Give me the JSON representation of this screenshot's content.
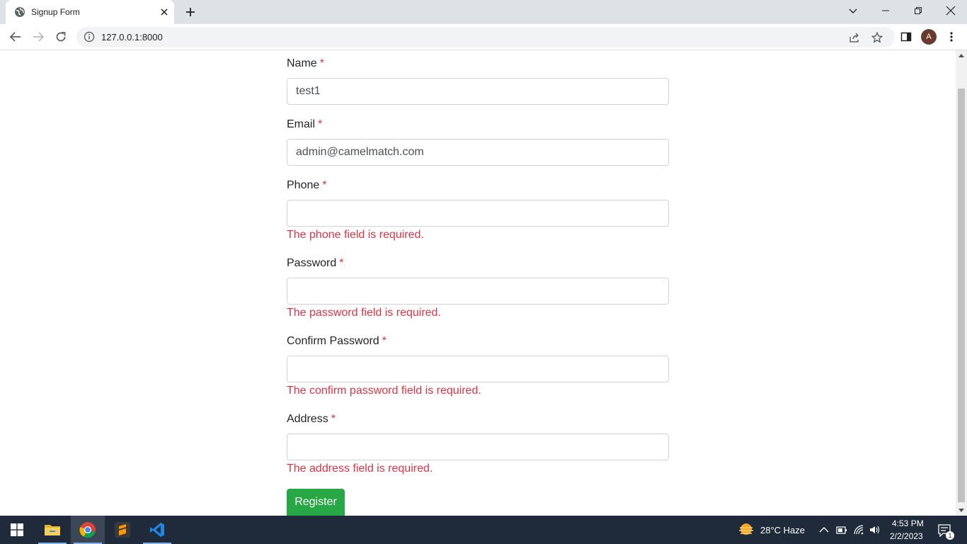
{
  "browser": {
    "tab_title": "Signup Form",
    "url": "127.0.0.1:8000",
    "profile_initial": "A"
  },
  "form": {
    "fields": [
      {
        "label": "Name",
        "required": "*",
        "value": "test1",
        "error": ""
      },
      {
        "label": "Email",
        "required": "*",
        "value": "admin@camelmatch.com",
        "error": ""
      },
      {
        "label": "Phone",
        "required": "*",
        "value": "",
        "error": "The phone field is required."
      },
      {
        "label": "Password",
        "required": "*",
        "value": "",
        "error": "The password field is required."
      },
      {
        "label": "Confirm Password",
        "required": "*",
        "value": "",
        "error": "The confirm password field is required."
      },
      {
        "label": "Address",
        "required": "*",
        "value": "",
        "error": "The address field is required."
      }
    ],
    "submit_label": "Register"
  },
  "taskbar": {
    "weather": "28°C  Haze",
    "time": "4:53 PM",
    "date": "2/2/2023",
    "notification_count": "1",
    "apps": [
      "start-icon",
      "file-explorer-icon",
      "chrome-icon",
      "sublime-text-icon",
      "vscode-icon"
    ]
  },
  "colors": {
    "error": "#dc3545",
    "success_button": "#28a745",
    "taskbar": "#1f2b3a"
  }
}
